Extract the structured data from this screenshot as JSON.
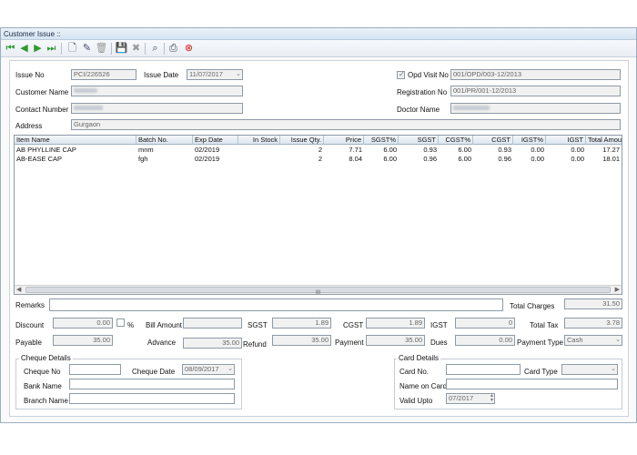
{
  "window": {
    "title": "Customer Issue ::"
  },
  "toolbar": {
    "icons": [
      "first-icon",
      "prev-icon",
      "next-icon",
      "last-icon",
      "new-icon",
      "edit-icon",
      "delete-icon",
      "save-icon",
      "cancel-icon",
      "search-icon",
      "print-icon",
      "close-icon"
    ]
  },
  "header": {
    "issue_no_label": "Issue No",
    "issue_no_value": "PCI/226526",
    "issue_date_label": "Issue Date",
    "issue_date_value": "11/07/2017",
    "opd_visit_label": "Opd Visit No",
    "opd_visit_value": "001/OPD/003-12/2013",
    "customer_name_label": "Customer Name",
    "registration_label": "Registration No",
    "registration_value": "001/PR/001-12/2013",
    "contact_label": "Contact Number",
    "doctor_label": "Doctor Name",
    "address_label": "Address",
    "address_value": "Gurgaon"
  },
  "grid": {
    "columns": [
      "Item Name",
      "Batch No.",
      "Exp Date",
      "In Stock",
      "Issue Qty.",
      "Price",
      "SGST%",
      "SGST",
      "CGST%",
      "CGST",
      "IGST%",
      "IGST",
      "Total Amount"
    ],
    "rows": [
      [
        "AB PHYLLINE CAP",
        "mnm",
        "02/2019",
        "",
        "2",
        "7.71",
        "6.00",
        "0.93",
        "6.00",
        "0.93",
        "0.00",
        "0.00",
        "17.27"
      ],
      [
        "AB-EASE CAP",
        "fgh",
        "02/2019",
        "",
        "2",
        "8.04",
        "6.00",
        "0.96",
        "6.00",
        "0.96",
        "0.00",
        "0.00",
        "18.01"
      ]
    ],
    "scroll_marker": "III"
  },
  "totals": {
    "remarks_label": "Remarks",
    "total_charges_label": "Total Charges",
    "total_charges_value": "31.50",
    "discount_label": "Discount",
    "discount_value": "0.00",
    "percent_label": "%",
    "bill_amount_label": "Bill Amount",
    "sgst_label": "SGST",
    "sgst_value": "1.89",
    "cgst_label": "CGST",
    "cgst_value": "1.89",
    "igst_label": "IGST",
    "igst_value": "0",
    "total_tax_label": "Total Tax",
    "total_tax_value": "3.78",
    "payable_label": "Payable",
    "payable_value": "35.00",
    "advance_label": "Advance",
    "advance_value": "35.00",
    "refund_label": "Refund",
    "refund_value": "35.00",
    "payment_label": "Payment",
    "payment_value": "35.00",
    "dues_label": "Dues",
    "dues_value": "0.00",
    "payment_type_label": "Payment Type",
    "payment_type_value": "Cash"
  },
  "cheque": {
    "title": "Cheque Details",
    "cheque_no_label": "Cheque No",
    "cheque_date_label": "Cheque Date",
    "cheque_date_value": "08/09/2017",
    "bank_name_label": "Bank Name",
    "branch_name_label": "Branch Name"
  },
  "card": {
    "title": "Card Details",
    "card_no_label": "Card No.",
    "card_type_label": "Card Type",
    "name_on_card_label": "Name on Card",
    "valid_upto_label": "Valid Upto",
    "valid_upto_value": "07/2017"
  },
  "colors": {
    "accent": "#2e9a2e",
    "danger": "#d42020",
    "border": "#8e9aa8"
  }
}
